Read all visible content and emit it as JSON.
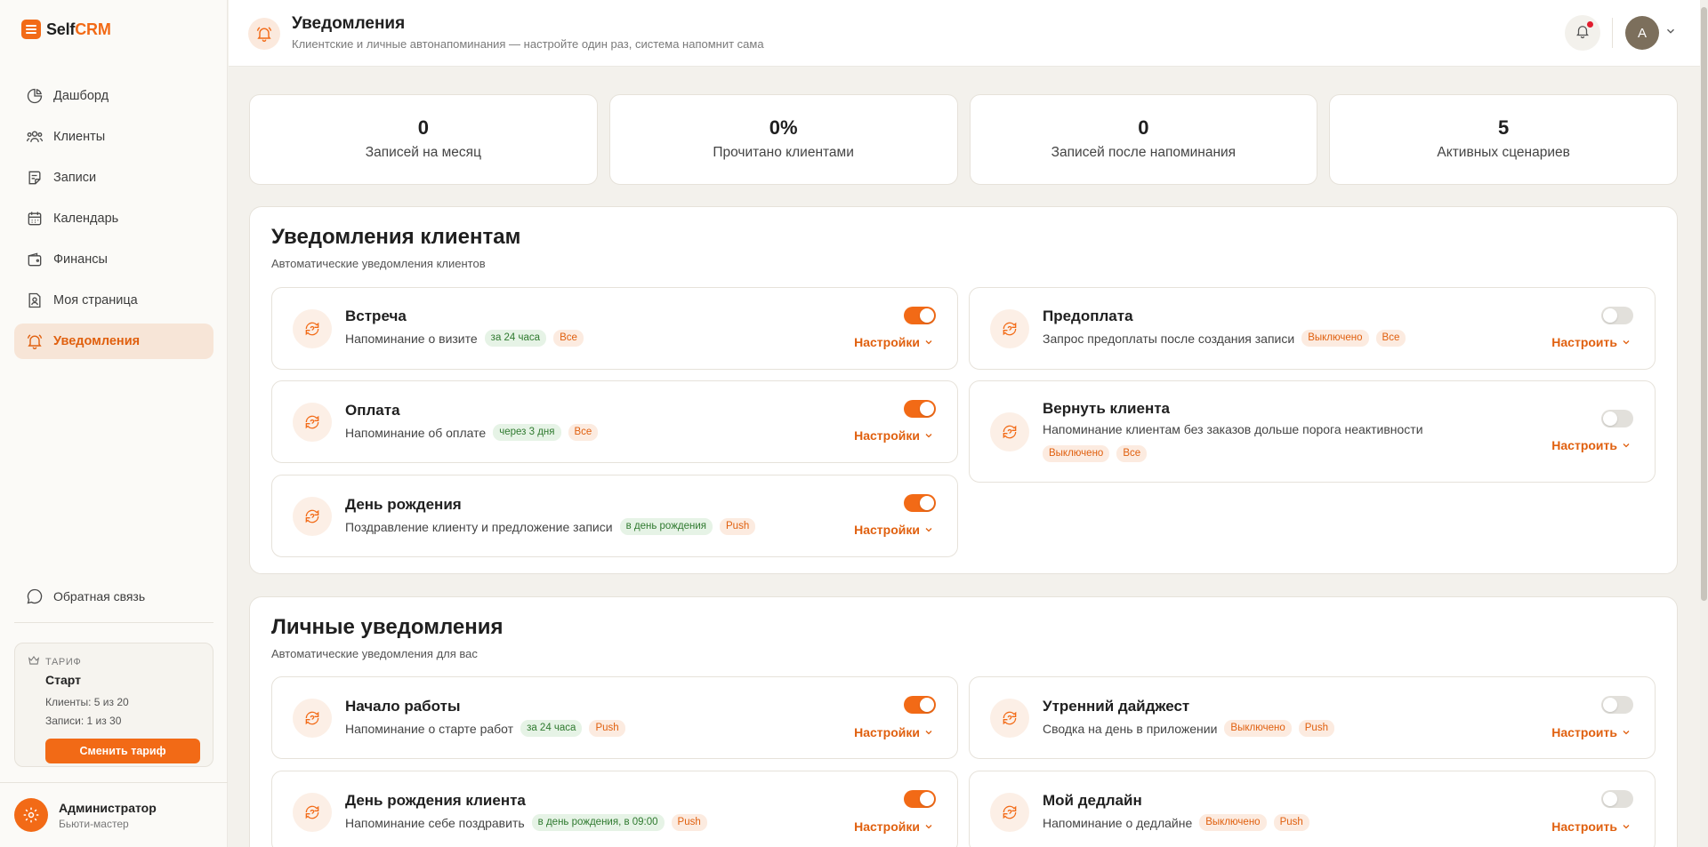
{
  "app": {
    "logo_part1": "Self",
    "logo_part2": "CRM"
  },
  "colors": {
    "accent": "#f26a16",
    "active_bg": "#f7e5d7",
    "tag_green_bg": "#e6f3e6",
    "tag_orange_bg": "#fcebe0"
  },
  "sidebar": {
    "items": [
      {
        "label": "Дашборд",
        "icon": "dashboard-pie-icon"
      },
      {
        "label": "Клиенты",
        "icon": "users-icon"
      },
      {
        "label": "Записи",
        "icon": "notes-icon"
      },
      {
        "label": "Календарь",
        "icon": "calendar-icon"
      },
      {
        "label": "Финансы",
        "icon": "wallet-icon"
      },
      {
        "label": "Моя страница",
        "icon": "profile-page-icon"
      },
      {
        "label": "Уведомления",
        "icon": "bell-icon",
        "active": true
      }
    ],
    "feedback": "Обратная связь",
    "tariff": {
      "label": "ТАРИФ",
      "name": "Старт",
      "clients": "Клиенты: 5 из 20",
      "records": "Записи: 1 из 30",
      "button": "Сменить тариф"
    },
    "profile": {
      "name": "Администратор",
      "role": "Бьюти-мастер"
    }
  },
  "header": {
    "title": "Уведомления",
    "subtitle": "Клиентские и личные автонапоминания — настройте один раз, система напомнит сама",
    "avatar_letter": "A"
  },
  "stats": [
    {
      "value": "0",
      "label": "Записей на месяц"
    },
    {
      "value": "0%",
      "label": "Прочитано клиентами"
    },
    {
      "value": "0",
      "label": "Записей после напоминания"
    },
    {
      "value": "5",
      "label": "Активных сценариев"
    }
  ],
  "client_section": {
    "title": "Уведомления клиентам",
    "subtitle": "Автоматические уведомления клиентов",
    "cards": [
      {
        "title": "Встреча",
        "desc": "Напоминание о визите",
        "tags": [
          "за 24 часа",
          "Все"
        ],
        "enabled": true,
        "action": "Настройки"
      },
      {
        "title": "Предоплата",
        "desc": "Запрос предоплаты после создания записи",
        "tags": [
          "Выключено",
          "Все"
        ],
        "enabled": false,
        "action": "Настроить"
      },
      {
        "title": "Оплата",
        "desc": "Напоминание об оплате",
        "tags": [
          "через 3 дня",
          "Все"
        ],
        "enabled": true,
        "action": "Настройки"
      },
      {
        "title": "Вернуть клиента",
        "desc": "Напоминание клиентам без заказов дольше порога неактивности",
        "tags": [
          "Выключено",
          "Все"
        ],
        "enabled": false,
        "action": "Настроить"
      },
      {
        "title": "День рождения",
        "desc": "Поздравление клиенту и предложение записи",
        "tags": [
          "в день рождения",
          "Push"
        ],
        "enabled": true,
        "action": "Настройки"
      }
    ]
  },
  "personal_section": {
    "title": "Личные уведомления",
    "subtitle": "Автоматические уведомления для вас",
    "cards": [
      {
        "title": "Начало работы",
        "desc": "Напоминание о старте работ",
        "tags": [
          "за 24 часа",
          "Push"
        ],
        "enabled": true,
        "action": "Настройки"
      },
      {
        "title": "Утренний дайджест",
        "desc": "Сводка на день в приложении",
        "tags": [
          "Выключено",
          "Push"
        ],
        "enabled": false,
        "action": "Настроить"
      },
      {
        "title": "День рождения клиента",
        "desc": "Напоминание себе поздравить",
        "tags": [
          "в день рождения, в 09:00",
          "Push"
        ],
        "enabled": true,
        "action": "Настройки"
      },
      {
        "title": "Мой дедлайн",
        "desc": "Напоминание о дедлайне",
        "tags": [
          "Выключено",
          "Push"
        ],
        "enabled": false,
        "action": "Настроить"
      }
    ]
  }
}
